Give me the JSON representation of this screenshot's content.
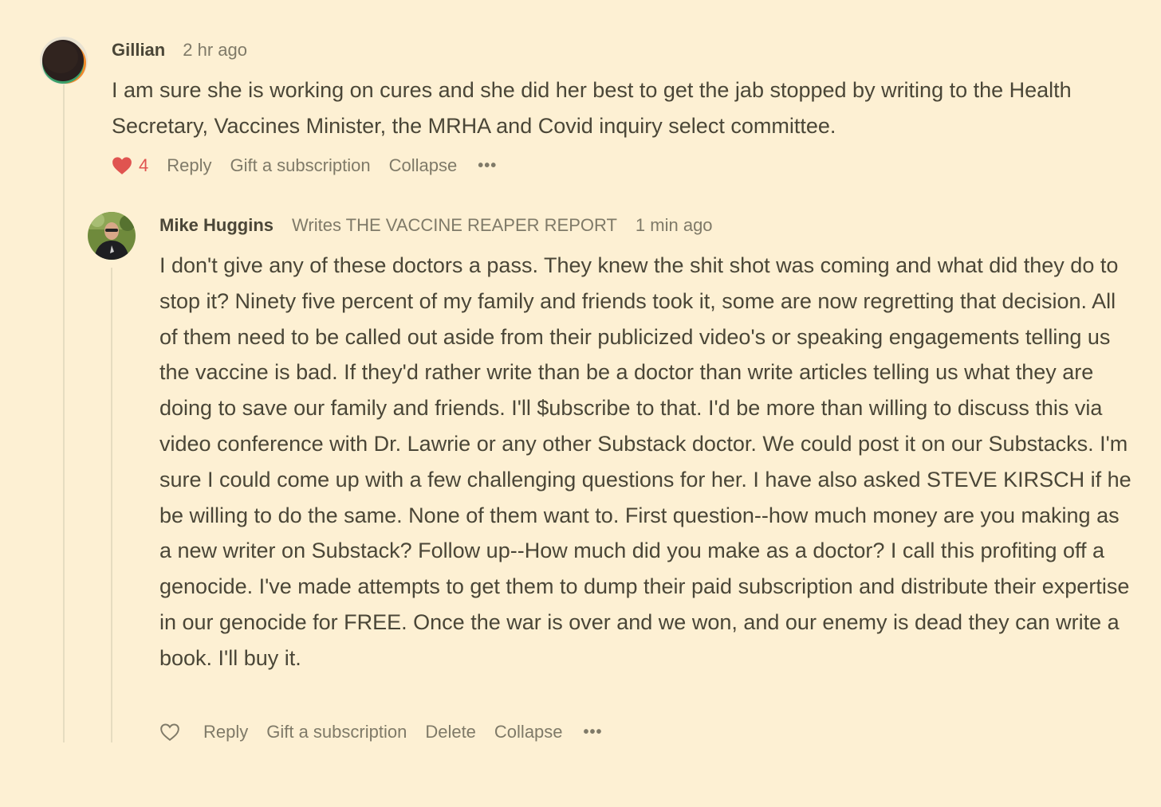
{
  "comments": [
    {
      "author": "Gillian",
      "timestamp": "2 hr ago",
      "body": "I am sure she is working on cures and she did her best to get the jab stopped by writing to the Health Secretary, Vaccines Minister, the MRHA and Covid inquiry select committee.",
      "likes": "4",
      "liked": true,
      "actions": {
        "reply": "Reply",
        "gift": "Gift a subscription",
        "collapse": "Collapse",
        "more": "•••"
      }
    },
    {
      "author": "Mike Huggins",
      "byline": "Writes THE VACCINE REAPER REPORT",
      "timestamp": "1 min ago",
      "body": "I don't give any of these doctors a pass. They knew the shit shot was coming and what did they do to stop it? Ninety five percent of my family and friends took it, some are now regretting that decision. All of them need to be called out aside from their publicized video's or speaking engagements telling us the vaccine is bad. If they'd rather write than be a doctor than write articles telling us what they are doing to save our family and friends. I'll $ubscribe to that. I'd be more than willing to discuss this via video conference with Dr. Lawrie or any other Substack doctor. We could post it on our Substacks. I'm sure I could come up with a few challenging questions for her. I have also asked STEVE KIRSCH if he be willing to do the same. None of them want to. First question--how much money are you making as a new writer on Substack? Follow up--How much did you make as a doctor? I call this profiting off a genocide. I've made attempts to get them to dump their paid subscription and distribute their expertise in our genocide for FREE. Once the war is over and we won, and our enemy is dead they can write a book. I'll buy it.",
      "liked": false,
      "actions": {
        "reply": "Reply",
        "gift": "Gift a subscription",
        "delete": "Delete",
        "collapse": "Collapse",
        "more": "•••"
      }
    }
  ],
  "icons": {
    "like_filled": "heart-filled-icon",
    "like_empty": "heart-outline-icon",
    "more": "more-dots-icon"
  },
  "colors": {
    "background": "#fdf0d3",
    "text": "#4a4637",
    "subtle": "#7f7a68",
    "like": "#e05450",
    "thread_line": "#e6dcc0"
  }
}
